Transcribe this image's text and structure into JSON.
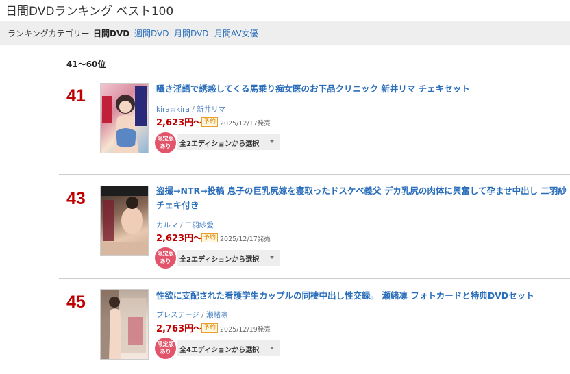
{
  "page": {
    "title": "日間DVDランキング ベスト100"
  },
  "categories": {
    "label": "ランキングカテゴリー",
    "active": "日間DVD",
    "links": [
      "週間DVD",
      "月間DVD",
      "月間AV女優"
    ]
  },
  "range": "41〜60位",
  "items": [
    {
      "rank": "41",
      "title_lines": [
        "囁き淫語で誘惑してくる馬乗り痴女医のお下品クリニック 新井リマ チェキセット"
      ],
      "maker": "kira☆kira",
      "actress": "新井リマ",
      "price": "2,623円〜",
      "badge": "予約",
      "date": "2025/12/17発売",
      "limited": [
        "限定版",
        "あり"
      ],
      "select": "全2エディションから選択"
    },
    {
      "rank": "43",
      "title_lines": [
        "盗撮→NTR→投稿 息子の巨乳尻嫁を寝取ったドスケベ義父 デカ乳尻の肉体に興奮して孕ませ中出し 二羽紗",
        "チェキ付き"
      ],
      "maker": "カルマ",
      "actress": "二羽紗愛",
      "price": "2,623円〜",
      "badge": "予約",
      "date": "2025/12/17発売",
      "limited": [
        "限定版",
        "あり"
      ],
      "select": "全2エディションから選択"
    },
    {
      "rank": "45",
      "title_lines": [
        "性欲に支配された看護学生カップルの同棲中出し性交録。 瀬緒凛 フォトカードと特典DVDセット"
      ],
      "maker": "プレステージ",
      "actress": "瀬緒凛",
      "price": "2,763円〜",
      "badge": "予約",
      "date": "2025/12/19発売",
      "limited": [
        "限定版",
        "あり"
      ],
      "select": "全4エディションから選択"
    }
  ]
}
